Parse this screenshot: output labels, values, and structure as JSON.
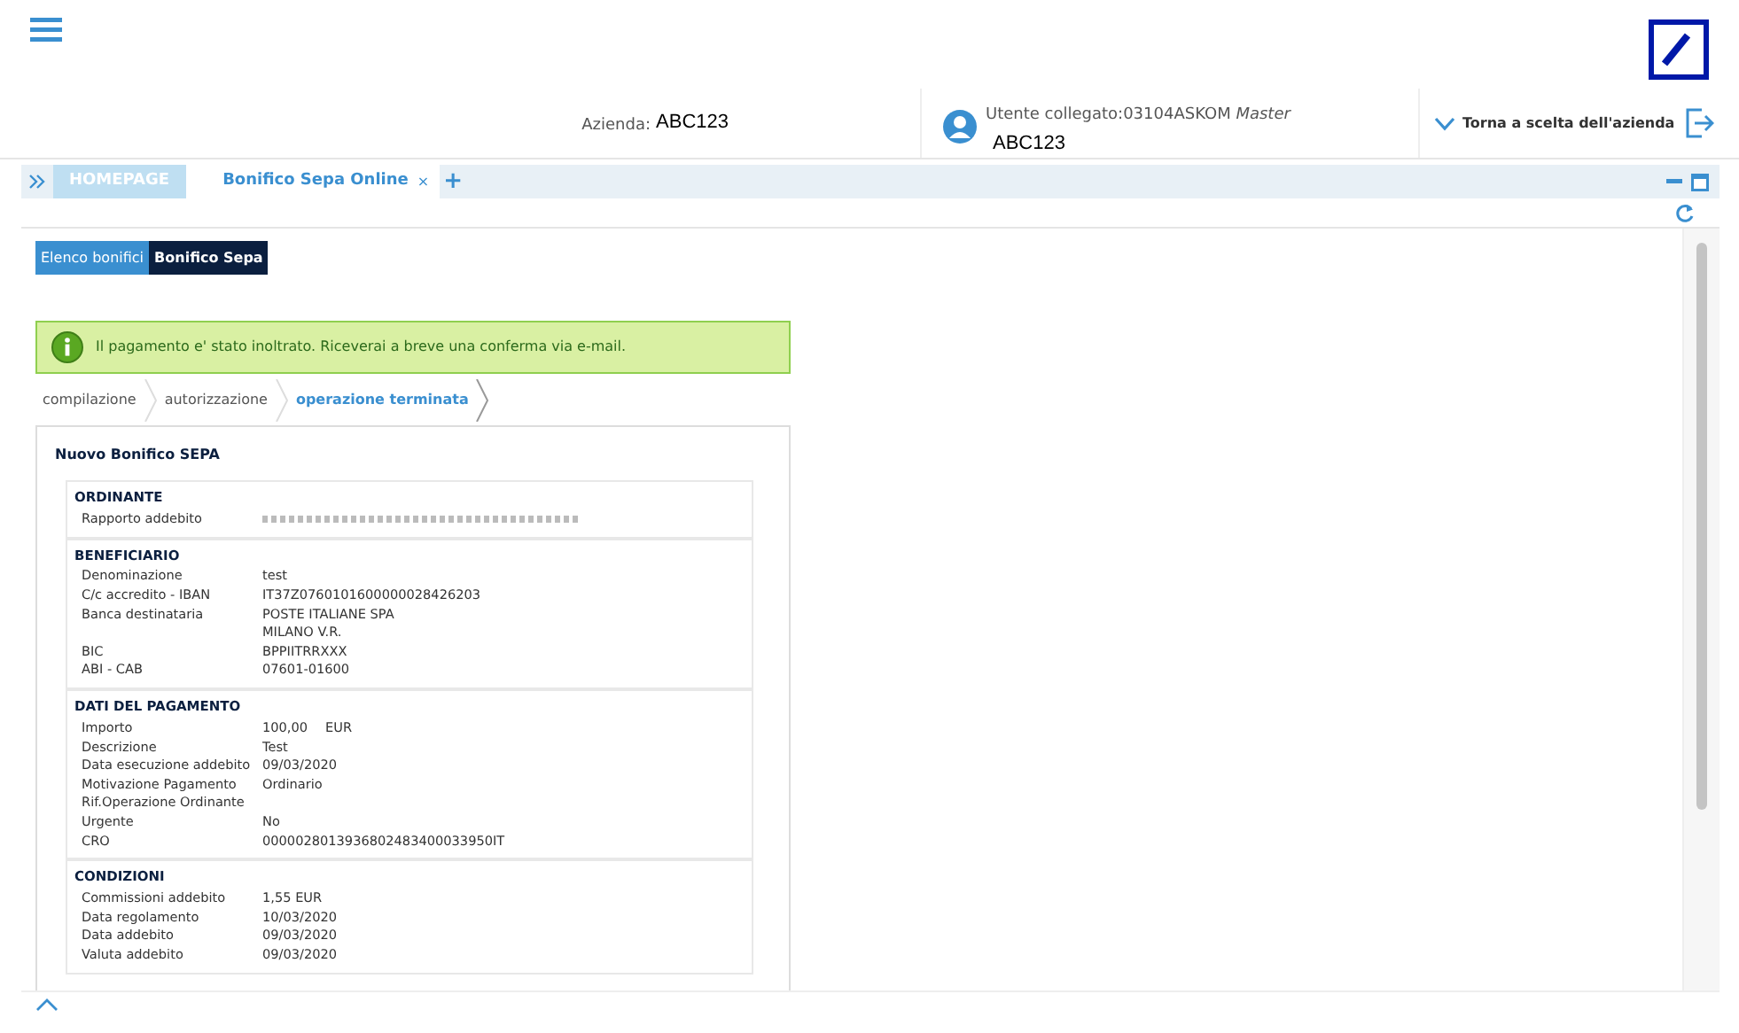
{
  "header": {
    "company_label": "Azienda:",
    "company": "ABC123",
    "user_label": "Utente collegato:03104ASKOM",
    "user_role": "Master",
    "user_company": "ABC123",
    "back_link": "Torna a scelta dell'azienda"
  },
  "tabs": [
    {
      "label": "HOMEPAGE",
      "selected": false
    },
    {
      "label": "Bonifico Sepa Online",
      "selected": true,
      "close": "×"
    }
  ],
  "add_tab": "+",
  "subtabs": [
    {
      "label": "Elenco bonifici",
      "selected": false
    },
    {
      "label": "Bonifico Sepa",
      "selected": true
    }
  ],
  "message": "Il pagamento e' stato inoltrato. Riceverai a breve una conferma via e-mail.",
  "steps": [
    {
      "label": "compilazione",
      "selected": false
    },
    {
      "label": "autorizzazione",
      "selected": false
    },
    {
      "label": "operazione terminata",
      "selected": true
    }
  ],
  "card_title": "Nuovo Bonifico SEPA",
  "sections": [
    {
      "title": "ORDINANTE",
      "rows": [
        {
          "kind": "redacted",
          "label": "Rapporto addebito"
        }
      ]
    },
    {
      "title": "BENEFICIARIO",
      "rows": [
        {
          "kind": "text",
          "label": "Denominazione",
          "value": "test"
        },
        {
          "kind": "text",
          "label": "C/c accredito - IBAN",
          "value": "IT37Z0760101600000028426203"
        },
        {
          "kind": "text",
          "label": "Banca destinataria",
          "value": "POSTE ITALIANE SPA"
        },
        {
          "kind": "text",
          "value": "MILANO V.R."
        },
        {
          "kind": "text",
          "label": "BIC",
          "value": "BPPIITRRXXX"
        },
        {
          "kind": "text",
          "label": "ABI - CAB",
          "value": "07601-01600"
        }
      ]
    },
    {
      "title": "DATI DEL PAGAMENTO",
      "rows": [
        {
          "kind": "text",
          "label": "Importo",
          "value": "100,00",
          "unit": "EUR"
        },
        {
          "kind": "text",
          "label": "Descrizione",
          "value": "Test"
        },
        {
          "kind": "text",
          "label": "Data esecuzione addebito",
          "value": "09/03/2020"
        },
        {
          "kind": "text",
          "label": "Motivazione Pagamento",
          "value": "Ordinario"
        },
        {
          "kind": "text",
          "label": "Rif.Operazione Ordinante"
        },
        {
          "kind": "text",
          "label": "Urgente",
          "value": "No"
        },
        {
          "kind": "text",
          "label": "CRO",
          "value": "0000028013936802483400033950IT"
        }
      ]
    },
    {
      "title": "CONDIZIONI",
      "rows": [
        {
          "kind": "text",
          "label": "Commissioni addebito",
          "value": "1,55 EUR"
        },
        {
          "kind": "text",
          "label": "Data regolamento",
          "value": "10/03/2020"
        },
        {
          "kind": "text",
          "label": "Data addebito",
          "value": "09/03/2020"
        },
        {
          "kind": "text",
          "label": "Valuta addebito",
          "value": "09/03/2020"
        }
      ]
    }
  ]
}
